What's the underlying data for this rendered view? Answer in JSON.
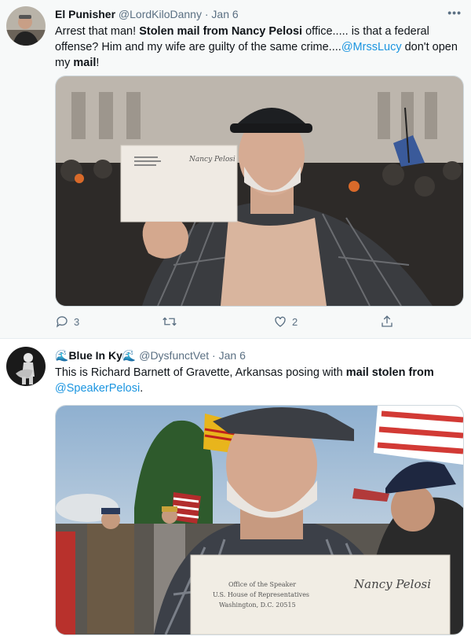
{
  "tweet1": {
    "display_name": "El Punisher",
    "handle": "@LordKiloDanny",
    "separator": "·",
    "date": "Jan 6",
    "more_icon": "more-icon",
    "text_parts": [
      "Arrest that man! ",
      "Stolen mail from Nancy Pelosi",
      " office..... is that a federal offense? Him and my wife are guilty of the same crime....",
      "@MrssLucy",
      " don't open my ",
      "mail",
      "!"
    ],
    "image_envelope_text": "Nancy Pelosi",
    "actions": {
      "reply_count": "3",
      "retweet_count": "",
      "like_count": "2"
    }
  },
  "tweet2": {
    "display_name": "Blue In Ky",
    "handle": "@DysfunctVet",
    "separator": "·",
    "date": "Jan 6",
    "text_parts": [
      "This is Richard Barnett of Gravette, Arkansas posing with ",
      "mail stolen from",
      " ",
      "@SpeakerPelosi",
      "."
    ],
    "envelope": {
      "return_line1": "Office of the Speaker",
      "return_line2": "U.S. House of Representatives",
      "return_line3": "Washington, D.C. 20515",
      "signature": "Nancy Pelosi"
    }
  },
  "colors": {
    "link": "#1b95e0",
    "meta": "#5b7083",
    "wave_emoji": "#1da1f2"
  }
}
